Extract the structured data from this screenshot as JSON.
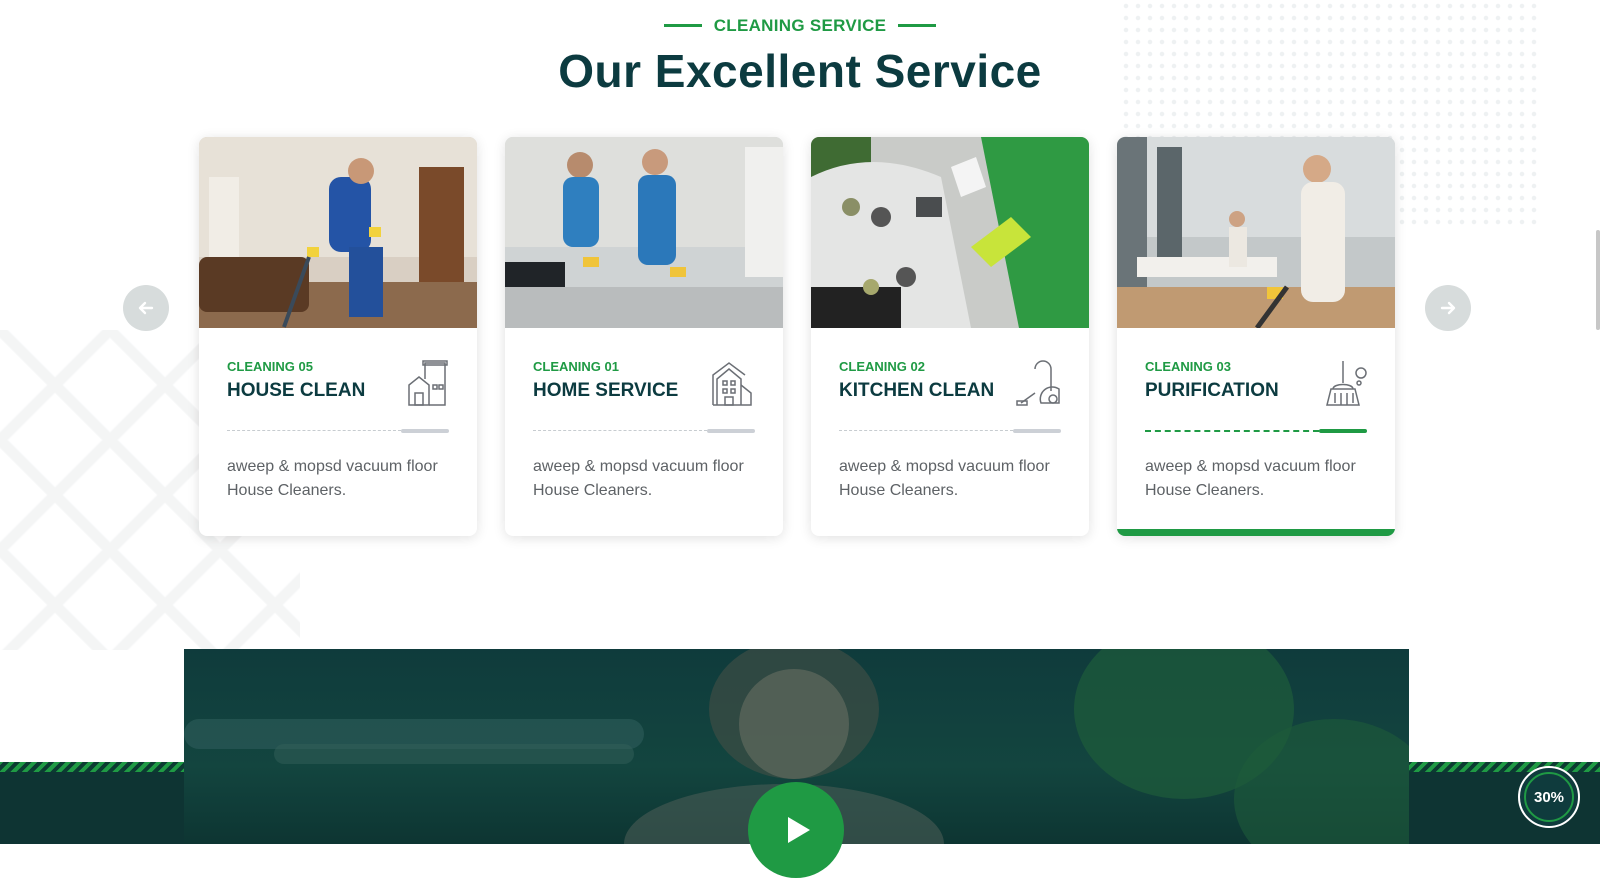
{
  "section": {
    "subtitle": "CLEANING SERVICE",
    "title": "Our Excellent Service"
  },
  "cards": [
    {
      "number": "CLEANING 05",
      "name": "HOUSE CLEAN",
      "description": "aweep & mopsd vacuum floor House Cleaners.",
      "icon": "house-icon"
    },
    {
      "number": "CLEANING 01",
      "name": "HOME SERVICE",
      "description": "aweep & mopsd vacuum floor House Cleaners.",
      "icon": "building-icon"
    },
    {
      "number": "CLEANING 02",
      "name": "KITCHEN CLEAN",
      "description": "aweep & mopsd vacuum floor House Cleaners.",
      "icon": "vacuum-icon"
    },
    {
      "number": "CLEANING 03",
      "name": "PURIFICATION",
      "description": "aweep & mopsd vacuum floor House Cleaners.",
      "icon": "broom-icon"
    }
  ],
  "active_card_index": 3,
  "navigation": {
    "prev_icon": "arrow-left-icon",
    "next_icon": "arrow-right-icon"
  },
  "video": {
    "play_icon": "play-icon"
  },
  "scroll_progress": {
    "label": "30%",
    "value": 0.3
  },
  "colors": {
    "accent": "#1f9a44",
    "heading": "#0c3b40",
    "text": "#5e6266",
    "dark": "#0e3433"
  }
}
